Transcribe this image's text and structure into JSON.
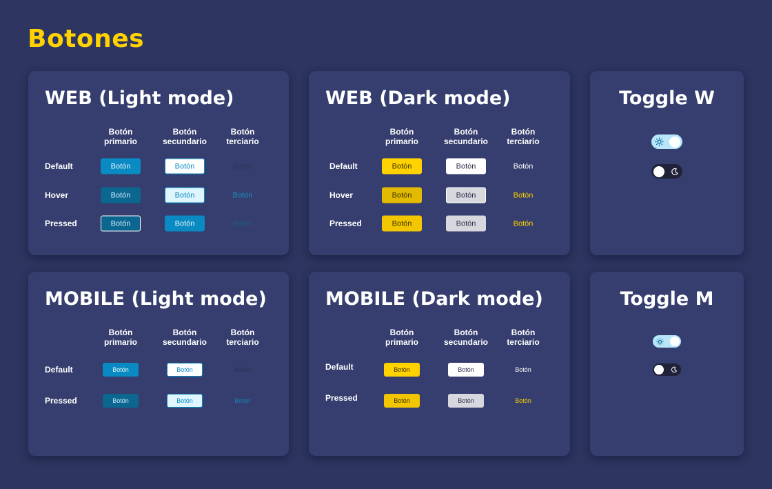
{
  "page": {
    "title": "Botones"
  },
  "columns": [
    "Botón\nprimario",
    "Botón\nsecundario",
    "Botón\nterciario"
  ],
  "button_label": "Botón",
  "rows": {
    "default": "Default",
    "hover": "Hover",
    "pressed": "Pressed"
  },
  "cards": {
    "web_light": {
      "title": "WEB (Light mode)"
    },
    "web_dark": {
      "title": "WEB (Dark mode)"
    },
    "mobile_light": {
      "title": "MOBILE (Light mode)"
    },
    "mobile_dark": {
      "title": "MOBILE (Dark mode)"
    },
    "toggle_web": {
      "title": "Toggle W"
    },
    "toggle_mobile": {
      "title": "Toggle M"
    }
  },
  "colors": {
    "background": "#2d3560",
    "card": "#353e6e",
    "accent_yellow": "#ffd200",
    "primary_blue": "#0a8ac2",
    "primary_blue_dark": "#0b6690",
    "toggle_light": "#b7e6fb",
    "toggle_dark": "#1f2238"
  },
  "icons": {
    "light_toggle": "sun-icon",
    "dark_toggle": "moon-icon"
  }
}
